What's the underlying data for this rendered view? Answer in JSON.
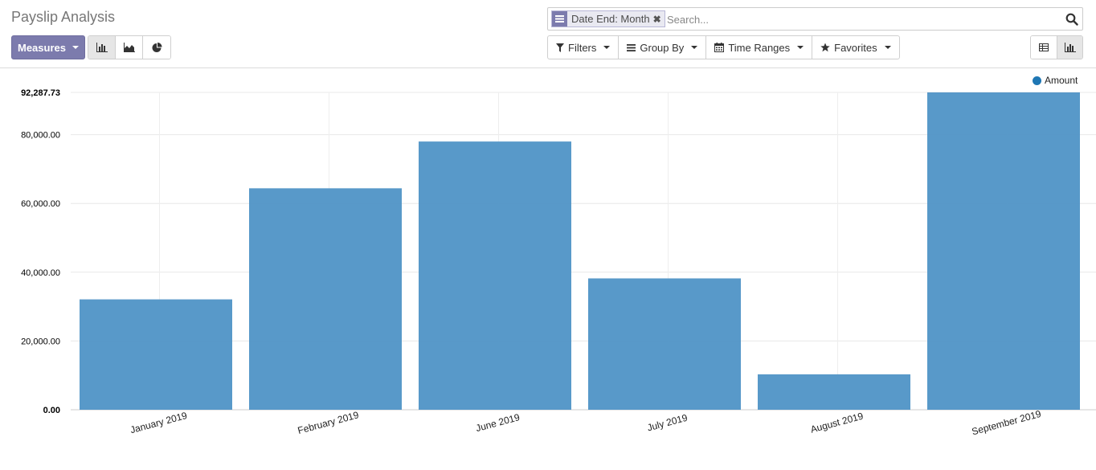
{
  "header": {
    "title": "Payslip Analysis",
    "measures_label": "Measures"
  },
  "chart_modes": [
    {
      "name": "bar",
      "icon": "bar-chart-icon",
      "active": true
    },
    {
      "name": "line",
      "icon": "area-chart-icon",
      "active": false
    },
    {
      "name": "pie",
      "icon": "pie-chart-icon",
      "active": false
    }
  ],
  "search": {
    "facet_label": "Date End: Month",
    "placeholder": "Search..."
  },
  "search_options": {
    "filters": "Filters",
    "group_by": "Group By",
    "time_ranges": "Time Ranges",
    "favorites": "Favorites"
  },
  "views": [
    {
      "name": "pivot",
      "icon": "table-icon",
      "active": false
    },
    {
      "name": "graph",
      "icon": "bar-chart-icon",
      "active": true
    }
  ],
  "colors": {
    "accent": "#7c7bad",
    "bar": "#4f93c6",
    "legend": "#1f77b4"
  },
  "chart_data": {
    "type": "bar",
    "categories": [
      "January 2019",
      "February 2019",
      "June 2019",
      "July 2019",
      "August 2019",
      "September 2019"
    ],
    "series": [
      {
        "name": "Amount",
        "values": [
          32100,
          64400,
          78000,
          38200,
          10300,
          92287.73
        ]
      }
    ],
    "ylim": [
      0,
      92287.73
    ],
    "yticks": [
      "0.00",
      "20,000.00",
      "40,000.00",
      "60,000.00",
      "80,000.00",
      "92,287.73"
    ],
    "ytick_values": [
      0,
      20000,
      40000,
      60000,
      80000,
      92287.73
    ],
    "grid": true,
    "legend": "top-right",
    "legend_label": "Amount"
  }
}
